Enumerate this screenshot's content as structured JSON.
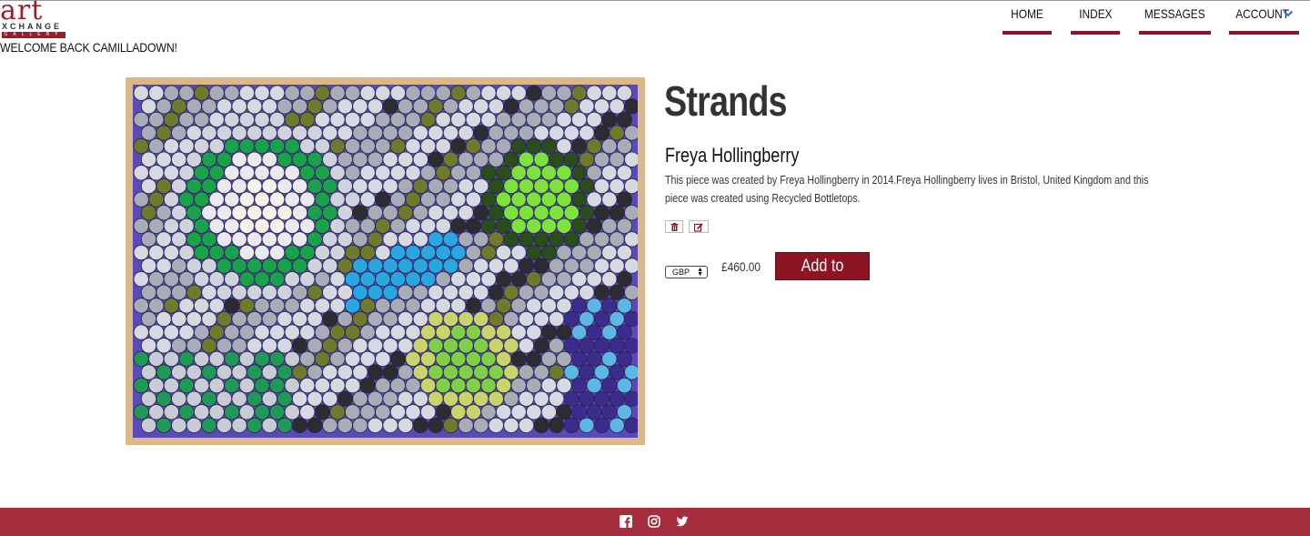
{
  "logo": {
    "line1": "art",
    "line2": "XCHANGE",
    "line3": "GALLERY"
  },
  "welcome_text": "WELCOME BACK CAMILLADOWN!",
  "nav": {
    "home": "HOME",
    "index": "INDEX",
    "messages": "MESSAGES",
    "account": "ACCOUNT"
  },
  "artwork": {
    "title": "Strands",
    "artist": "Freya Hollingberry",
    "description": "This piece was created by Freya Hollingberry in 2014.Freya Hollingberry lives in Bristol, United Kingdom and this piece was created using Recycled Bottletops.",
    "image_icon": "bottle-cap-mosaic-artwork"
  },
  "purchase": {
    "currency": "GBP",
    "price": "£460.00",
    "add_to_basket": "Add to basket"
  },
  "actions": {
    "delete_icon": "trash-icon",
    "edit_icon": "edit-icon"
  },
  "footer": {
    "icons": [
      "facebook-icon",
      "instagram-icon",
      "twitter-icon"
    ]
  },
  "colors": {
    "brand": "#8c1524",
    "footer": "#a52d3e",
    "nav_chevron": "#2a6fdb"
  }
}
